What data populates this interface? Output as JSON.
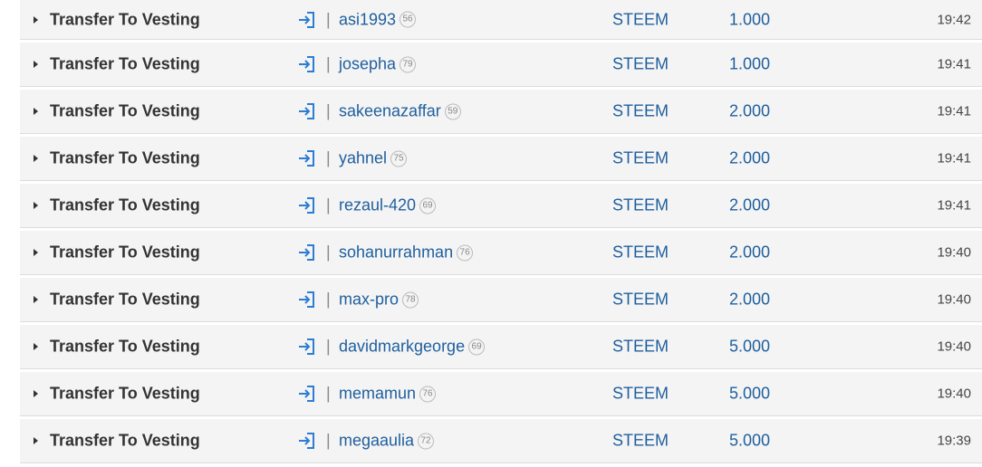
{
  "rows": [
    {
      "op": "Transfer To Vesting",
      "user": "asi1993",
      "rep": "56",
      "asset": "STEEM",
      "amount": "1.000",
      "time": "19:42"
    },
    {
      "op": "Transfer To Vesting",
      "user": "josepha",
      "rep": "79",
      "asset": "STEEM",
      "amount": "1.000",
      "time": "19:41"
    },
    {
      "op": "Transfer To Vesting",
      "user": "sakeenazaffar",
      "rep": "59",
      "asset": "STEEM",
      "amount": "2.000",
      "time": "19:41"
    },
    {
      "op": "Transfer To Vesting",
      "user": "yahnel",
      "rep": "75",
      "asset": "STEEM",
      "amount": "2.000",
      "time": "19:41"
    },
    {
      "op": "Transfer To Vesting",
      "user": "rezaul-420",
      "rep": "69",
      "asset": "STEEM",
      "amount": "2.000",
      "time": "19:41"
    },
    {
      "op": "Transfer To Vesting",
      "user": "sohanurrahman",
      "rep": "76",
      "asset": "STEEM",
      "amount": "2.000",
      "time": "19:40"
    },
    {
      "op": "Transfer To Vesting",
      "user": "max-pro",
      "rep": "78",
      "asset": "STEEM",
      "amount": "2.000",
      "time": "19:40"
    },
    {
      "op": "Transfer To Vesting",
      "user": "davidmarkgeorge",
      "rep": "69",
      "asset": "STEEM",
      "amount": "5.000",
      "time": "19:40"
    },
    {
      "op": "Transfer To Vesting",
      "user": "memamun",
      "rep": "76",
      "asset": "STEEM",
      "amount": "5.000",
      "time": "19:40"
    },
    {
      "op": "Transfer To Vesting",
      "user": "megaaulia",
      "rep": "72",
      "asset": "STEEM",
      "amount": "5.000",
      "time": "19:39"
    }
  ],
  "separator": "|",
  "icons": {
    "expand": "caret-right-icon",
    "direction": "sign-in-icon"
  },
  "colors": {
    "link": "#1f5f9e",
    "icon": "#2d7dd2",
    "row_bg": "#f4f4f4"
  }
}
